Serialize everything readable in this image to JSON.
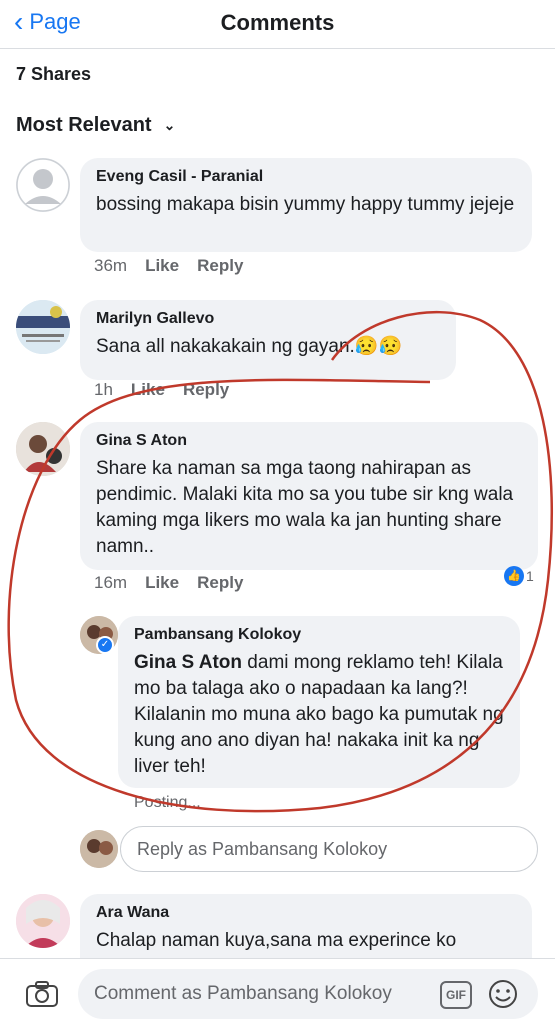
{
  "header": {
    "back_label": "Page",
    "title": "Comments"
  },
  "shares": "7 Shares",
  "sort": {
    "label": "Most Relevant"
  },
  "comments": [
    {
      "name": "Eveng Casil - Paranial",
      "text": "bossing makapa bisin yummy happy tummy jejeje",
      "time": "36m",
      "like": "Like",
      "reply": "Reply"
    },
    {
      "name": "Marilyn Gallevo",
      "text": "Sana all nakakakain ng gayan.😥😥",
      "time": "1h",
      "like": "Like",
      "reply": "Reply"
    },
    {
      "name": "Gina S Aton",
      "text": "Share ka naman sa mga taong nahirapan as pendimic. Malaki kita mo sa you tube sir kng wala kaming mga likers mo wala ka jan hunting share namn..",
      "time": "16m",
      "like": "Like",
      "reply": "Reply",
      "reactions": "1"
    },
    {
      "name": "Ara Wana",
      "text": "Chalap naman kuya,sana ma experince ko"
    }
  ],
  "reply": {
    "name": "Pambansang Kolokoy",
    "mention": "Gina S Aton",
    "text": " dami mong reklamo teh! Kilala mo ba talaga ako o napadaan ka lang?! Kilalanin mo muna ako bago ka pumutak ng kung ano ano diyan ha! nakaka init ka ng liver teh!",
    "status": "Posting..."
  },
  "reply_input": {
    "placeholder": "Reply as Pambansang Kolokoy"
  },
  "composer": {
    "placeholder": "Comment as Pambansang Kolokoy",
    "gif_label": "GIF"
  },
  "colors": {
    "accent": "#1877f2",
    "bubble": "#f0f2f5",
    "muted": "#65676b",
    "annotation": "#c0392b"
  },
  "icons": [
    "chevron-left-icon",
    "chevron-down-icon",
    "camera-icon",
    "gif-icon",
    "smiley-icon",
    "like-icon",
    "verified-icon"
  ]
}
